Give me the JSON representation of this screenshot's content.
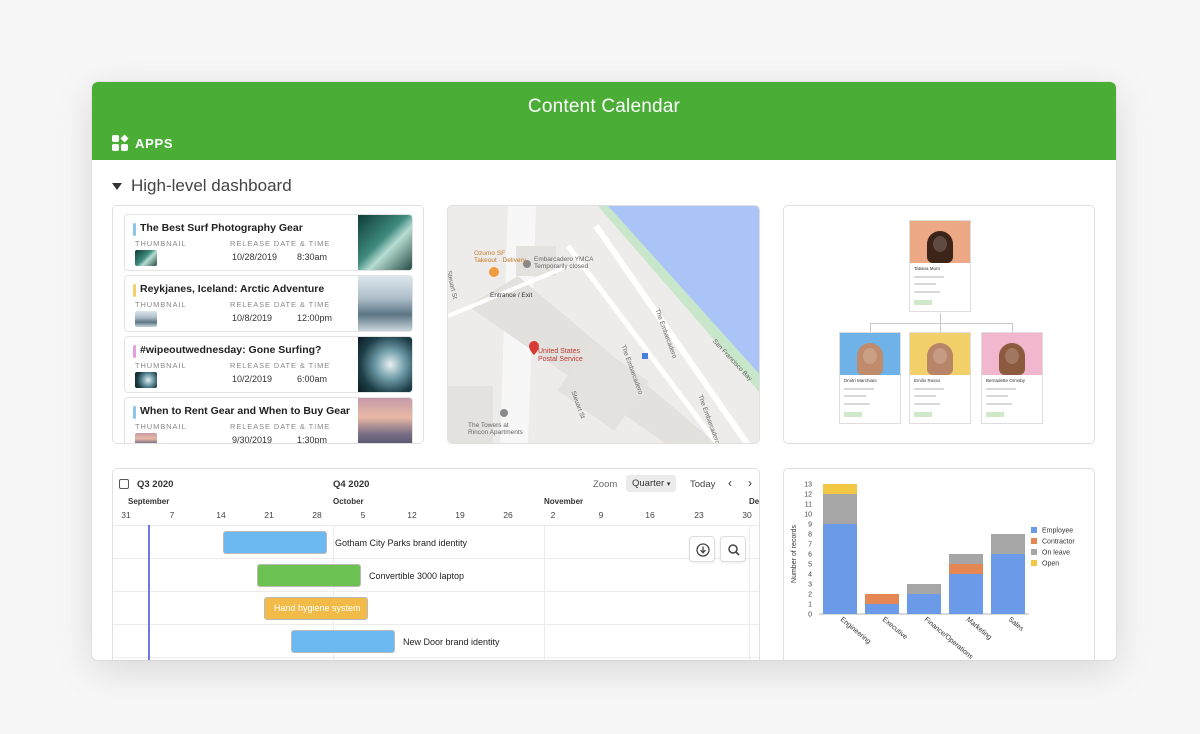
{
  "window": {
    "title": "Content Calendar",
    "apps_label": "APPS"
  },
  "section": {
    "title": "High-level dashboard"
  },
  "colors": {
    "brand": "#4aad36",
    "employee": "#6a9ae8",
    "contractor": "#e58752",
    "on_leave": "#a6a6a6",
    "open": "#f2c744"
  },
  "records": {
    "label_thumbnail": "THUMBNAIL",
    "label_release": "RELEASE DATE & TIME",
    "items": [
      {
        "title": "The Best Surf Photography Gear",
        "date": "10/28/2019",
        "time": "8:30am",
        "color": "#8ec5ee"
      },
      {
        "title": "Reykjanes, Iceland: Arctic Adventure",
        "date": "10/8/2019",
        "time": "12:00pm",
        "color": "#f4d06b"
      },
      {
        "title": "#wipeoutwednesday: Gone Surfing?",
        "date": "10/2/2019",
        "time": "6:00am",
        "color": "#e79ee0"
      },
      {
        "title": "When to Rent Gear and When to Buy Gear",
        "date": "9/30/2019",
        "time": "1:30pm",
        "color": "#8ec5ee"
      }
    ]
  },
  "map": {
    "labels": {
      "ozumo": "Ozumo SF\nTakeout · Delivery",
      "ymca": "Embarcadero YMCA\nTemporarily closed",
      "entrance": "Entrance / Exit",
      "steuart": "Steuart St",
      "postal": "United States\nPostal Service",
      "towers": "The Towers at\nRincon Apartments",
      "embarcadero_1": "The Embarcadero",
      "embarcadero_2": "The Embarcadero",
      "embarcadero_3": "The Embarcadero",
      "bay": "San Francisco Bay",
      "steuart_2": "Steuart St"
    }
  },
  "org": {
    "top": {
      "name": "Tatiana Muro"
    },
    "children": [
      {
        "name": "Dmitri Marchiani"
      },
      {
        "name": "Emilio Russo"
      },
      {
        "name": "Bernadette Ormsby"
      }
    ]
  },
  "timeline": {
    "q3": "Q3 2020",
    "q4": "Q4 2020",
    "zoom_label": "Zoom",
    "zoom_value": "Quarter",
    "today": "Today",
    "prev": "‹",
    "next": "›",
    "months": [
      "September",
      "October",
      "November",
      "De"
    ],
    "days": [
      "31",
      "7",
      "14",
      "21",
      "28",
      "5",
      "12",
      "19",
      "26",
      "2",
      "9",
      "16",
      "23",
      "30"
    ],
    "bars": [
      {
        "name": "Gotham City Parks brand identity",
        "color": "#6bb9f0"
      },
      {
        "name": "Convertible 3000 laptop",
        "color": "#6bc253"
      },
      {
        "name": "Hand hygiene system",
        "color": "#f2bb48"
      },
      {
        "name": "New Door brand identity",
        "color": "#6bb9f0"
      }
    ],
    "download_icon": "download-icon",
    "search_icon": "search-icon"
  },
  "chart_data": {
    "type": "bar",
    "stacked": true,
    "categories": [
      "Engineering",
      "Executive",
      "Finance/Operations",
      "Marketing",
      "Sales"
    ],
    "series": [
      {
        "name": "Employee",
        "values": [
          9,
          1,
          2,
          4,
          6
        ],
        "color": "#6a9ae8"
      },
      {
        "name": "Contractor",
        "values": [
          0,
          1,
          0,
          1,
          0
        ],
        "color": "#e58752"
      },
      {
        "name": "On leave",
        "values": [
          3,
          0,
          1,
          1,
          2
        ],
        "color": "#a6a6a6"
      },
      {
        "name": "Open",
        "values": [
          1,
          0,
          0,
          0,
          0
        ],
        "color": "#f2c744"
      }
    ],
    "ylabel": "Number of records",
    "ylim": [
      0,
      13
    ],
    "yticks": [
      "0",
      "1",
      "2",
      "3",
      "4",
      "5",
      "6",
      "7",
      "8",
      "9",
      "10",
      "11",
      "12",
      "13"
    ],
    "legend": "right"
  }
}
